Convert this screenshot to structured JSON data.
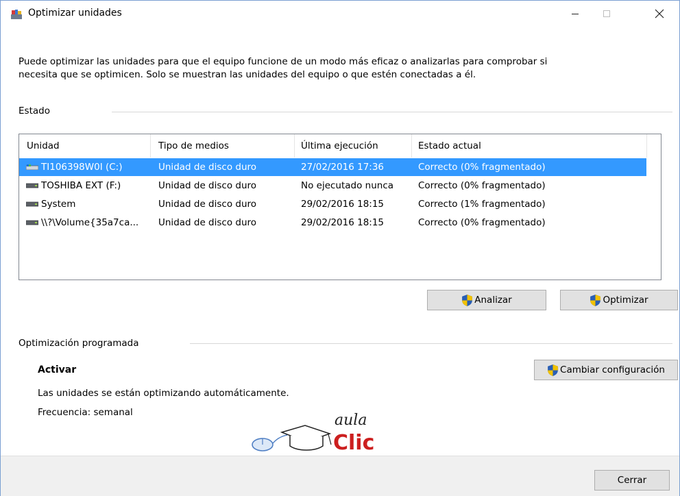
{
  "window": {
    "title": "Optimizar unidades",
    "controls": {
      "minimize": "minimize-icon",
      "maximize": "maximize-icon",
      "close": "close-icon"
    }
  },
  "intro": {
    "line1": "Puede optimizar las unidades para que el equipo funcione de un modo más eficaz o analizarlas para comprobar si",
    "line2": "necesita que se optimicen. Solo se muestran las unidades del equipo o que estén conectadas a él."
  },
  "estado": {
    "label": "Estado",
    "columns": [
      "Unidad",
      "Tipo de medios",
      "Última ejecución",
      "Estado actual"
    ],
    "rows": [
      {
        "unidad": "TI106398W0I (C:)",
        "tipo": "Unidad de disco duro",
        "ultima": "27/02/2016 17:36",
        "estado": "Correcto (0% fragmentado)",
        "icon": "system-drive-icon",
        "selected": true
      },
      {
        "unidad": "TOSHIBA EXT (F:)",
        "tipo": "Unidad de disco duro",
        "ultima": "No ejecutado nunca",
        "estado": "Correcto (0% fragmentado)",
        "icon": "hard-drive-icon",
        "selected": false
      },
      {
        "unidad": "System",
        "tipo": "Unidad de disco duro",
        "ultima": "29/02/2016 18:15",
        "estado": "Correcto (1% fragmentado)",
        "icon": "hard-drive-icon",
        "selected": false
      },
      {
        "unidad": "\\\\?\\Volume{35a7ca...",
        "tipo": "Unidad de disco duro",
        "ultima": "29/02/2016 18:15",
        "estado": "Correcto (0% fragmentado)",
        "icon": "hard-drive-icon",
        "selected": false
      }
    ],
    "buttons": {
      "analizar": "Analizar",
      "optimizar": "Optimizar"
    }
  },
  "programada": {
    "label": "Optimización programada",
    "status": "Activar",
    "description": "Las unidades se están optimizando automáticamente.",
    "frequency": "Frecuencia: semanal",
    "change_button": "Cambiar configuración"
  },
  "logo": {
    "word1": "aula",
    "word2": "Clic"
  },
  "footer": {
    "close_button": "Cerrar"
  },
  "colors": {
    "selection": "#3399ff",
    "button_face": "#e1e1e1",
    "footer_bg": "#f0f0f0",
    "logo_red": "#cc1f1f",
    "shield_blue": "#2a5fb5",
    "shield_yellow": "#f2c200"
  }
}
